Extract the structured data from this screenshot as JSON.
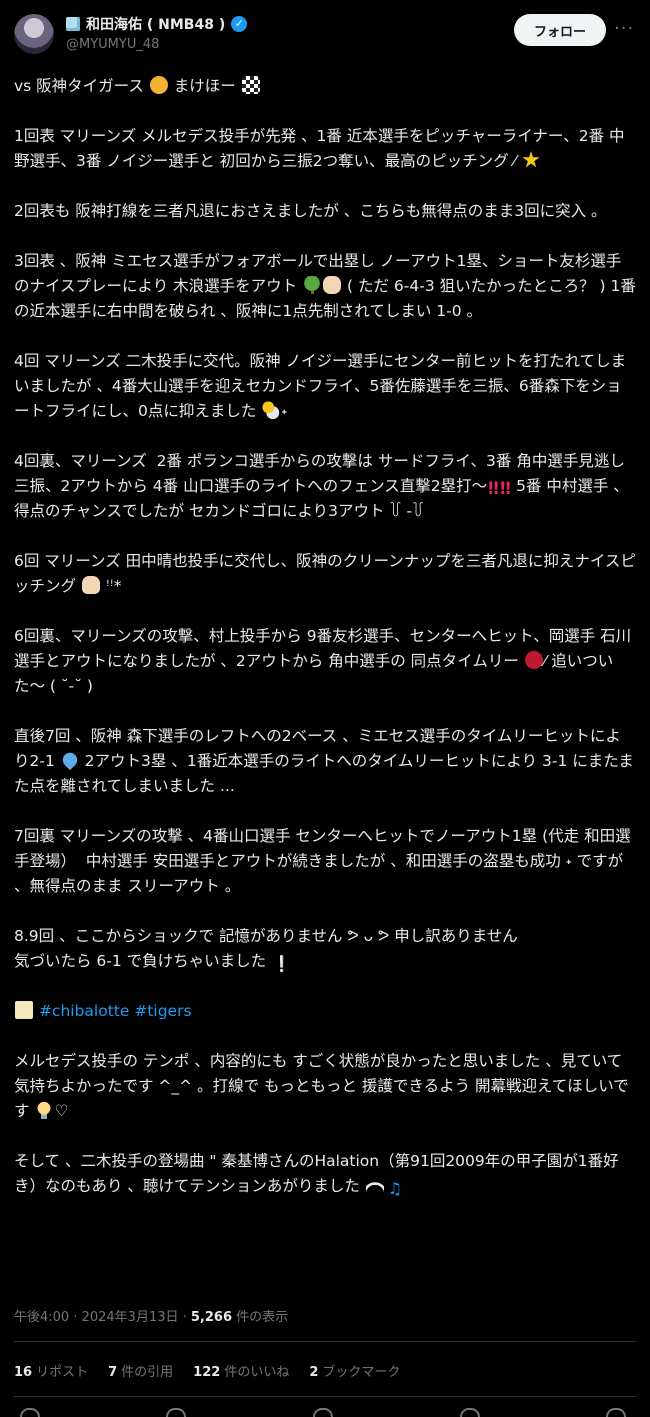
{
  "header": {
    "display_name": "和田海佑 ( NMB48 )",
    "handle": "@MYUMYU_48",
    "follow_label": "フォロー",
    "more_label": "···"
  },
  "tweet": {
    "p1": "vs 阪神タイガース",
    "p1b": " まけほー ",
    "p2": "1回表 マリーンズ メルセデス投手が先発 、1番 近本選手をピッチャーライナー、2番 中野選手、3番 ノイジー選手と 初回から三振2つ奪い、最高のピッチング ⁄ ",
    "p3": "2回表も 阪神打線を三者凡退におさえましたが 、こちらも無得点のまま3回に突入 。",
    "p4a": "3回表 、阪神 ミエセス選手がフォアボールで出塁し ノーアウト1塁、ショート友杉選手のナイスプレーにより 木浪選手をアウト ",
    "p4b": " ( ただ 6-4-3 狙いたかったところ？ ) 1番の近本選手に右中間を破られ 、阪神に1点先制されてしまい 1-0 。",
    "p5": "4回 マリーンズ 二木投手に交代。阪神 ノイジー選手にセンター前ヒットを打たれてしまいましたが 、4番大山選手を迎えセカンドフライ、5番佐藤選手を三振、6番森下をショートフライにし、0点に抑えました ",
    "p5b": "˖",
    "p6a": "4回裏、マリーンズ  2番 ポランコ選手からの攻撃は サードフライ、3番 角中選手見逃し三振、2アウトから 4番 山口選手のライトへのフェンス直撃2塁打〜",
    "p6b": " 5番 中村選手 、得点のチャンスでしたが セカンドゴロにより3アウト ꒦ -꒦",
    "p7": "6回 マリーンズ 田中晴也投手に交代し、阪神のクリーンナップを三者凡退に抑えナイスピッチング ",
    "p7b": " ꜝꜝ*",
    "p8": "6回裏、マリーンズの攻撃、村上投手から 9番友杉選手、センターへヒット、岡選手 石川選手とアウトになりましたが 、2アウトから 角中選手の 同点タイムリー ",
    "p8b": "⁄ 追いついた〜 ( ˘-˘ )",
    "p9a": "直後7回 、阪神 森下選手のレフトへの2ベース 、ミエセス選手のタイムリーヒットにより2-1 ",
    "p9b": " 2アウト3塁 、1番近本選手のライトへのタイムリーヒットにより 3-1 にまたまた点を離されてしまいました ...",
    "p10": "7回裏 マリーンズの攻撃 、4番山口選手 センターへヒットでノーアウト1塁 (代走 和田選手登場）  中村選手 安田選手とアウトが続きましたが 、和田選手の盗塁も成功 ˖ ですが 、無得点のまま スリーアウト 。",
    "p11": "8.9回 、ここからショックで 記憶がありません ᕗ ᴗ ᕗ 申し訳ありません\n気づいたら 6-1 で負けちゃいました ",
    "hashtags": "#chibalotte #tigers",
    "p13": "メルセデス投手の テンポ 、内容的にも すごく状態が良かったと思いました 、見ていて気持ちよかったです ^_^ 。打線で もっともっと 援護できるよう 開幕戦迎えてほしいです ",
    "p13b": "♡",
    "p14": "そして 、二木投手の登場曲 \" 秦基博さんのHalation（第91回2009年の甲子園が1番好き）なのもあり 、聴けてテンションあがりました "
  },
  "meta": {
    "time": "午後4:00 · 2024年3月13日 · ",
    "views_count": "5,266",
    "views_label": " 件の表示"
  },
  "stats": {
    "reposts_count": "16",
    "reposts_label": "リポスト",
    "quotes_count": "7",
    "quotes_label": "件の引用",
    "likes_count": "122",
    "likes_label": "件のいいね",
    "bookmarks_count": "2",
    "bookmarks_label": "ブックマーク"
  },
  "colors": {
    "background": "#000000",
    "text": "#e7e9ea",
    "muted": "#71767b",
    "link": "#1d9bf0",
    "verified": "#1d9bf0"
  }
}
